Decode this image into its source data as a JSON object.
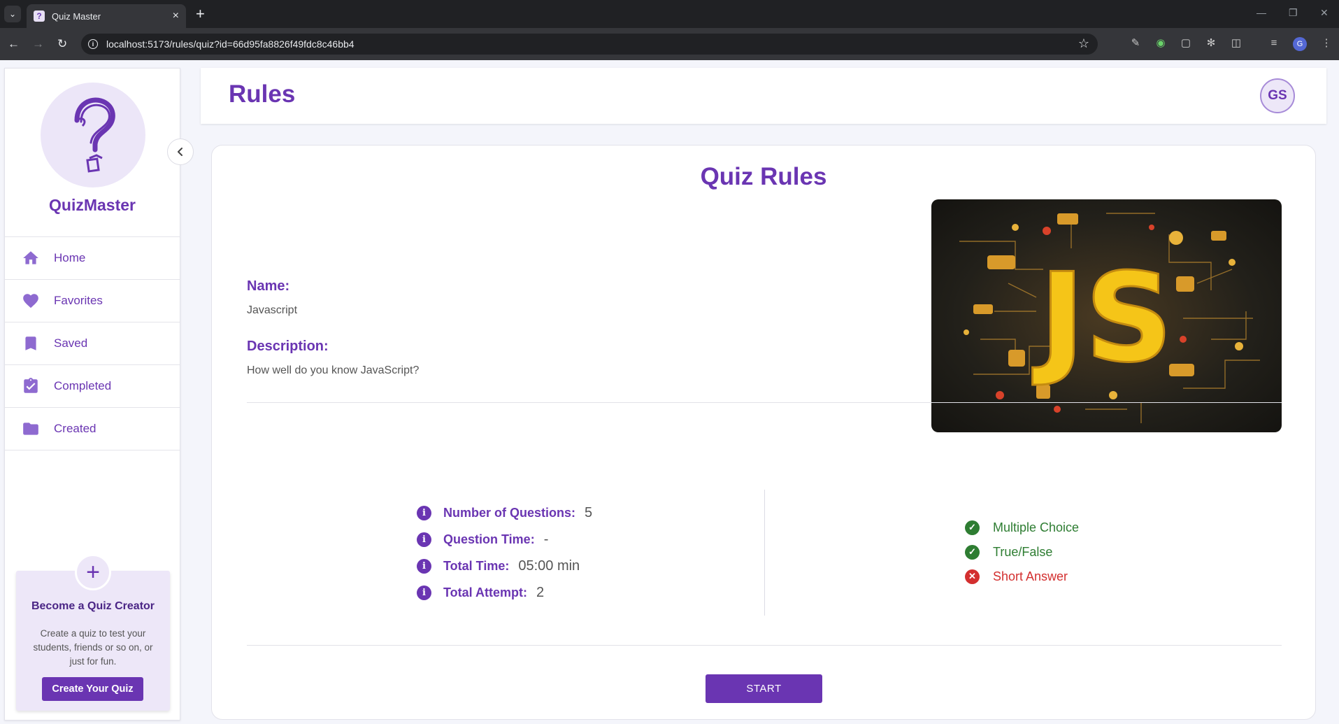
{
  "browser": {
    "tab_title": "Quiz Master",
    "url": "localhost:5173/rules/quiz?id=66d95fa8826f49fdc8c46bb4",
    "profile_initial": "G",
    "icons": [
      "tab-list-icon",
      "close-icon",
      "plus-icon",
      "back-icon",
      "forward-icon",
      "reload-icon",
      "info-icon",
      "star-icon",
      "eyedropper-icon",
      "extension-icon",
      "puzzle-icon",
      "media-icon"
    ]
  },
  "sidebar": {
    "brand": "QuizMaster",
    "items": [
      {
        "label": "Home",
        "icon": "home-icon"
      },
      {
        "label": "Favorites",
        "icon": "heart-icon"
      },
      {
        "label": "Saved",
        "icon": "bookmark-icon"
      },
      {
        "label": "Completed",
        "icon": "clipboard-check-icon"
      },
      {
        "label": "Created",
        "icon": "folder-icon"
      }
    ],
    "creator_card": {
      "title": "Become a Quiz Creator",
      "text": "Create a quiz to test your students, friends or so on, or just for fun.",
      "button": "Create Your Quiz"
    }
  },
  "header": {
    "title": "Rules",
    "avatar": "GS"
  },
  "main": {
    "card_title": "Quiz Rules",
    "name_label": "Name:",
    "name_value": "Javascript",
    "description_label": "Description:",
    "description_value": "How well do you know JavaScript?",
    "image_alt_text": "JS",
    "stats": [
      {
        "label": "Number of Questions:",
        "value": "5"
      },
      {
        "label": "Question Time:",
        "value": "-"
      },
      {
        "label": "Total Time:",
        "value": "05:00 min"
      },
      {
        "label": "Total Attempt:",
        "value": "2"
      }
    ],
    "question_types": [
      {
        "label": "Multiple Choice",
        "allowed": true
      },
      {
        "label": "True/False",
        "allowed": true
      },
      {
        "label": "Short Answer",
        "allowed": false
      }
    ],
    "start_button": "START"
  },
  "colors": {
    "accent": "#6a35b2",
    "allowed": "#2e7d32",
    "disallowed": "#d32f2f",
    "light_accent": "#ede7f8"
  }
}
